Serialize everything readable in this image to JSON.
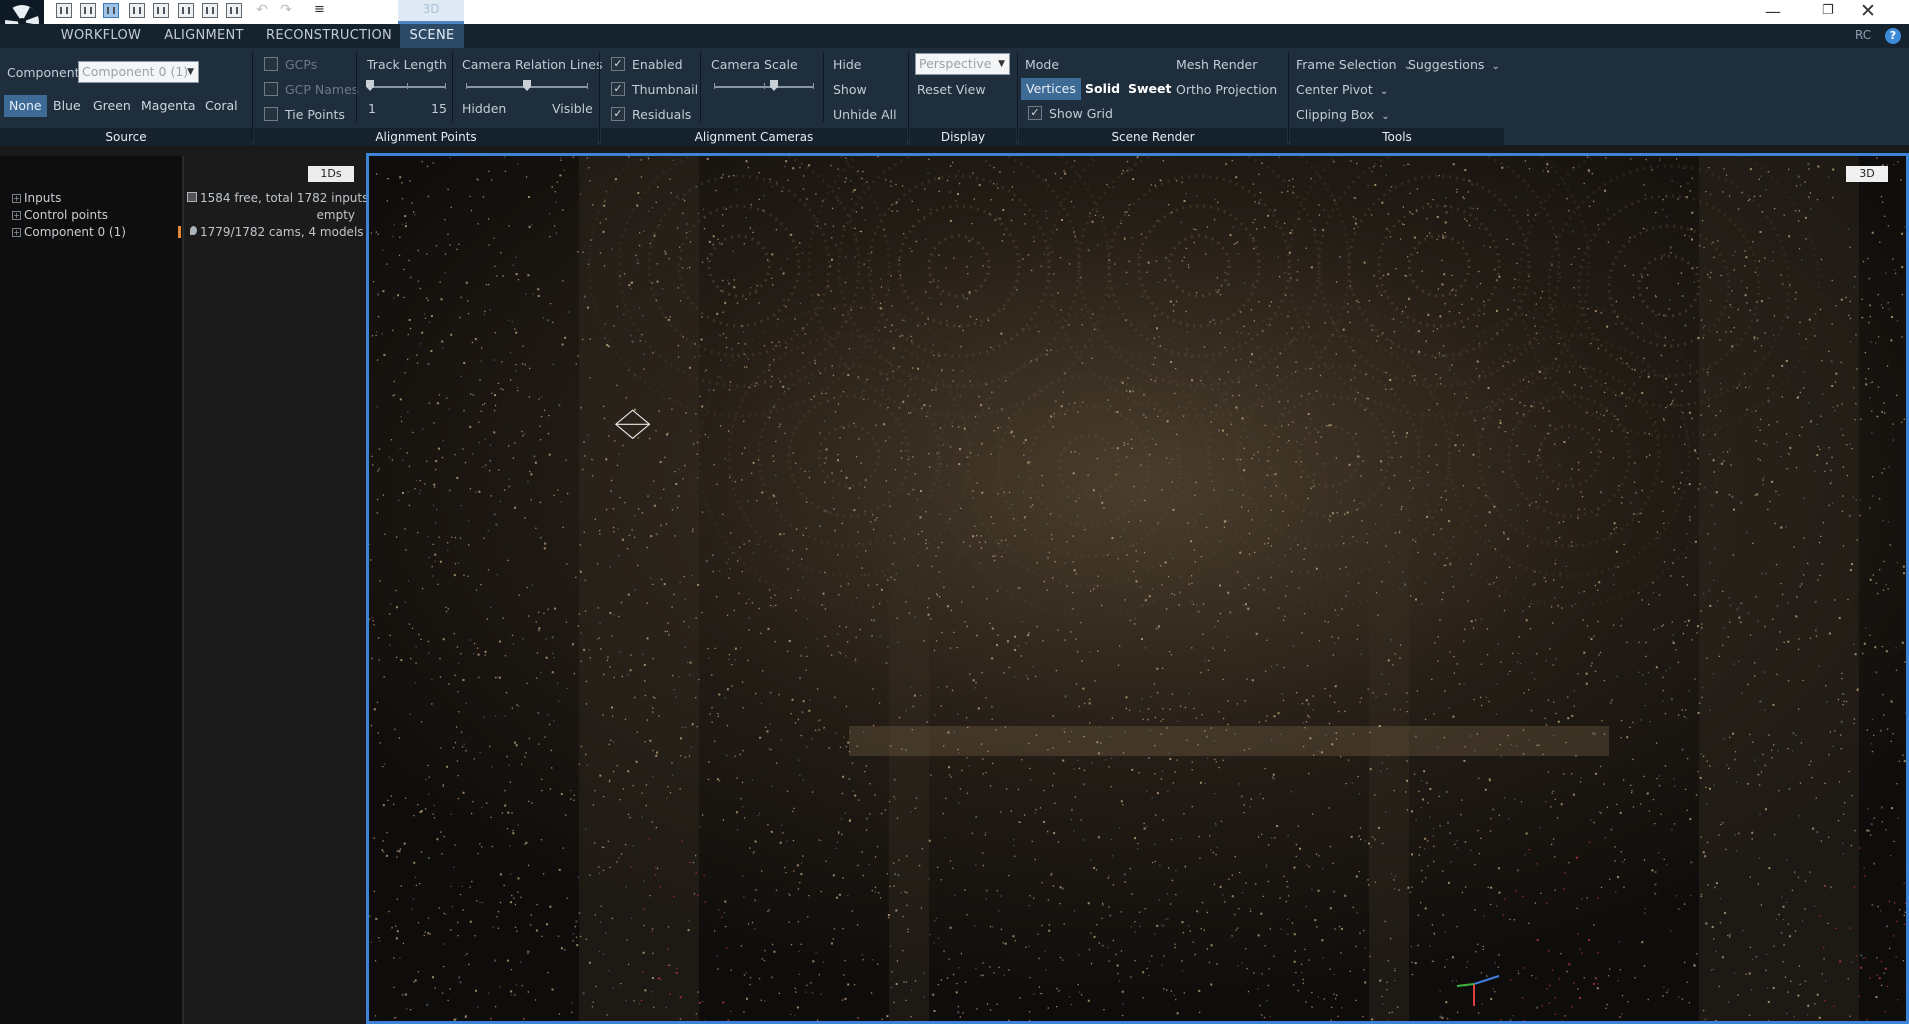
{
  "titlebar": {
    "dropdown_glyph": "≡",
    "active_tab": "3D",
    "window_controls": {
      "minimize": "—",
      "restore": "❐",
      "close": "✕"
    },
    "layout_icons": [
      "layout-1-icon",
      "layout-2-icon",
      "layout-3-icon",
      "layout-4-icon",
      "layout-5-icon",
      "layout-6-icon",
      "layout-7-icon",
      "layout-8-icon"
    ],
    "undo_glyph": "↶",
    "redo_glyph": "↷"
  },
  "menu": {
    "tabs": [
      "WORKFLOW",
      "ALIGNMENT",
      "RECONSTRUCTION",
      "SCENE"
    ],
    "active": "SCENE",
    "right_label": "RC",
    "help": "?"
  },
  "ribbon": {
    "source": {
      "label": "Source",
      "component_label": "Component",
      "component_value": "Component 0 (1)",
      "colors": [
        "None",
        "Blue",
        "Green",
        "Magenta",
        "Coral"
      ],
      "selected_color": "None"
    },
    "alignment_points": {
      "label": "Alignment Points",
      "checkboxes": [
        {
          "label": "GCPs",
          "checked": false
        },
        {
          "label": "GCP Names",
          "checked": false
        },
        {
          "label": "Tie Points",
          "checked": false
        }
      ],
      "track_length": {
        "label": "Track Length",
        "min": "1",
        "max": "15",
        "value_fraction": 0.0
      },
      "relation_lines": {
        "label": "Camera Relation Lines",
        "min_label": "Hidden",
        "max_label": "Visible",
        "value_fraction": 0.5
      }
    },
    "alignment_cameras": {
      "label": "Alignment Cameras",
      "checkboxes": [
        {
          "label": "Enabled",
          "checked": true
        },
        {
          "label": "Thumbnail",
          "checked": true
        },
        {
          "label": "Residuals",
          "checked": true
        }
      ],
      "camera_scale": {
        "label": "Camera Scale",
        "value_fraction": 0.6
      },
      "buttons": [
        "Hide",
        "Show",
        "Unhide All"
      ]
    },
    "display": {
      "label": "Display",
      "projection_value": "Perspective",
      "reset_view": "Reset View"
    },
    "scene_render": {
      "label": "Scene Render",
      "mode_label": "Mode",
      "modes": [
        "Vertices",
        "Solid",
        "Sweet"
      ],
      "selected_mode": "Vertices",
      "mesh_render": "Mesh Render",
      "ortho_projection": "Ortho Projection",
      "show_grid": {
        "label": "Show Grid",
        "checked": true
      }
    },
    "tools": {
      "label": "Tools",
      "frame_selection": "Frame Selection",
      "suggestions": "Suggestions",
      "center_pivot": "Center Pivot",
      "clipping_box": "Clipping Box"
    }
  },
  "tree": {
    "items": [
      "Inputs",
      "Control points",
      "Component 0 (1)"
    ]
  },
  "info": {
    "badge": "1Ds",
    "values": [
      "1584 free, total 1782 inputs",
      "empty",
      "1779/1782 cams, 4 models"
    ],
    "icons": [
      "image-stack-icon",
      "",
      "pin-icon"
    ]
  },
  "viewport": {
    "badge": "3D",
    "colors": {
      "border": "#3d84d6",
      "points_warm": "#c9ae86",
      "points_cool": "#8d8d8d",
      "points_red": "#a8323e",
      "cameras": "#ffffff"
    }
  }
}
